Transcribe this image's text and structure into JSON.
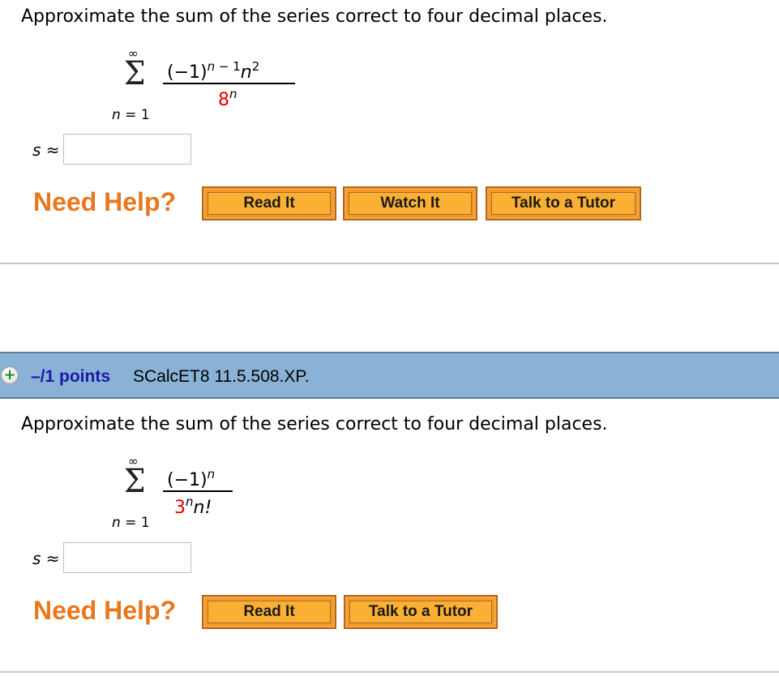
{
  "questions": [
    {
      "prompt": "Approximate the sum of the series correct to four decimal places.",
      "series": {
        "sigma": "Σ",
        "upper": "∞",
        "lower_var": "n",
        "lower_eq": " = 1",
        "numerator": {
          "base": "(−1)",
          "exp_var": "n",
          "exp_rest": " − 1",
          "tail_var": "n",
          "tail_exp": "2"
        },
        "denominator": {
          "base": "8",
          "exp": "n"
        }
      },
      "answer_label_var": "s",
      "answer_label_sym": " ≈",
      "answer_value": "",
      "need_help": "Need Help?",
      "buttons": [
        "Read It",
        "Watch It",
        "Talk to a Tutor"
      ]
    },
    {
      "header": {
        "icon": "plus-icon",
        "points": "–/1 points",
        "id": "SCalcET8 11.5.508.XP."
      },
      "prompt": "Approximate the sum of the series correct to four decimal places.",
      "series": {
        "sigma": "Σ",
        "upper": "∞",
        "lower_var": "n",
        "lower_eq": " = 1",
        "numerator": {
          "base": "(−1)",
          "exp": "n"
        },
        "denominator": {
          "base": "3",
          "exp": "n",
          "tail": "n!"
        }
      },
      "answer_label_var": "s",
      "answer_label_sym": " ≈",
      "answer_value": "",
      "need_help": "Need Help?",
      "buttons": [
        "Read It",
        "Talk to a Tutor"
      ]
    }
  ]
}
